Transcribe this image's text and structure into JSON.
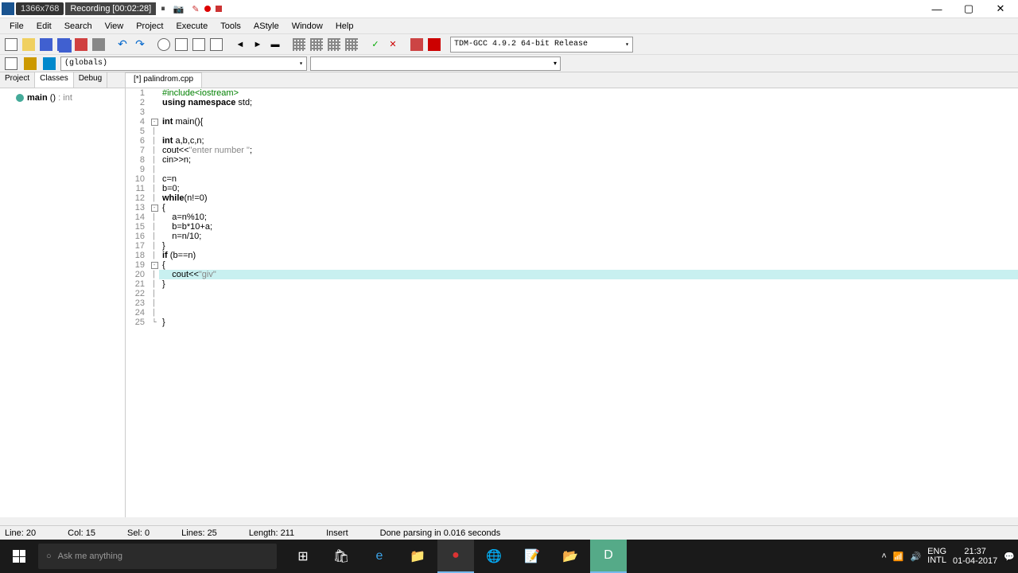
{
  "titlebar": {
    "resolution": "1366x768",
    "recording_label": "Recording",
    "recording_time": "[00:02:28]"
  },
  "menu": {
    "file": "File",
    "edit": "Edit",
    "search": "Search",
    "view": "View",
    "project": "Project",
    "execute": "Execute",
    "tools": "Tools",
    "astyle": "AStyle",
    "window": "Window",
    "help": "Help"
  },
  "compiler_selected": "TDM-GCC 4.9.2 64-bit Release",
  "scope_selected": "(globals)",
  "side_tabs": {
    "project": "Project",
    "classes": "Classes",
    "debug": "Debug"
  },
  "tree": {
    "main_label": "main () : int"
  },
  "file_tab": "[*] palindrom.cpp",
  "code": {
    "l1": "#include<iostream>",
    "l2": "using namespace std;",
    "l3": "",
    "l4": "int main(){",
    "l5": "",
    "l6": "int a,b,c,n;",
    "l7": "cout<<\"enter number \";",
    "l8": "cin>>n;",
    "l9": "",
    "l10": "c=n",
    "l11": "b=0;",
    "l12": "while(n!=0)",
    "l13": "{",
    "l14": "    a=n%10;",
    "l15": "    b=b*10+a;",
    "l16": "    n=n/10;",
    "l17": "}",
    "l18": "if (b==n)",
    "l19": "{",
    "l20_pre": "    cout<<\"",
    "l20_str": "giv",
    "l20_post": "\"",
    "l21": "}",
    "l22": "",
    "l23": "",
    "l24": "",
    "l25": "}"
  },
  "status": {
    "line": "Line:   20",
    "col": "Col:   15",
    "sel": "Sel:   0",
    "lines": "Lines:   25",
    "length": "Length:   211",
    "mode": "Insert",
    "parse": "Done parsing in 0.016 seconds"
  },
  "taskbar": {
    "search_placeholder": "Ask me anything",
    "lang": "ENG",
    "kb": "INTL",
    "time": "21:37",
    "date": "01-04-2017"
  }
}
